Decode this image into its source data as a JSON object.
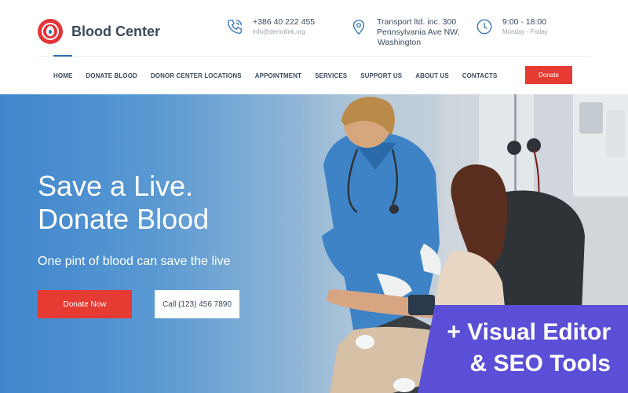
{
  "brand": {
    "name": "Blood Center"
  },
  "contacts": {
    "phone": {
      "main": "+386 40 222 455",
      "sub": "info@demolink.org"
    },
    "address": {
      "line1": "Transport ltd. inc. 300",
      "line2": "Pennsylvania Ave NW,",
      "line3": "Washington"
    },
    "hours": {
      "main": "9:00 - 18:00",
      "sub": "Monday - Friday"
    }
  },
  "nav": {
    "items": [
      {
        "label": "HOME"
      },
      {
        "label": "DONATE BLOOD"
      },
      {
        "label": "DONOR CENTER LOCATIONS"
      },
      {
        "label": "APPOINTMENT"
      },
      {
        "label": "SERVICES"
      },
      {
        "label": "SUPPORT US"
      },
      {
        "label": "ABOUT US"
      },
      {
        "label": "CONTACTS"
      }
    ],
    "active": "HOME",
    "donate_label": "Donate"
  },
  "hero": {
    "title_line1": "Save a Live.",
    "title_line2": "Donate Blood",
    "subtitle": "One pint of blood can save the live",
    "primary_button": "Donate Now",
    "secondary_button": "Call (123) 456 7890"
  },
  "promo": {
    "line1": "+ Visual Editor",
    "line2": "& SEO Tools"
  },
  "icons": {
    "logo": "blood-drop-logo-icon",
    "phone": "phone-icon",
    "location": "map-pin-icon",
    "hours": "clock-icon"
  },
  "colors": {
    "accent_red": "#e53b32",
    "brand_blue": "#2b6fb6",
    "promo_purple": "#5a4fd6",
    "text_dark": "#3a4a5c"
  }
}
